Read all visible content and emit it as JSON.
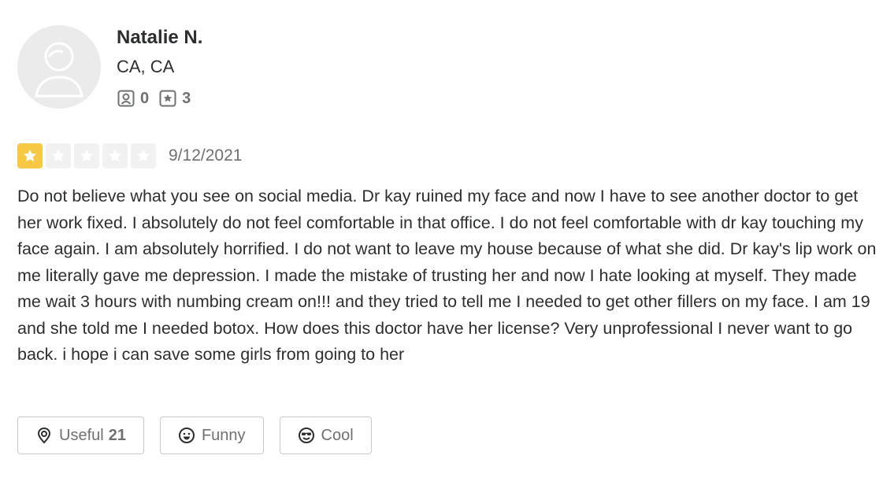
{
  "user": {
    "name": "Natalie N.",
    "location": "CA, CA",
    "friends_icon": "friends-icon",
    "friends_count": "0",
    "reviews_icon": "reviews-star-icon",
    "reviews_count": "3"
  },
  "review": {
    "rating": 1,
    "max_rating": 5,
    "rating_color": "#f7c844",
    "date": "9/12/2021",
    "text": "Do not believe what you see on social media. Dr kay ruined my face and now I have to see another doctor to get her work fixed. I absolutely do not feel comfortable in that office. I do not feel comfortable with dr kay touching my face again. I am absolutely horrified. I do not want to leave my house because of what she did. Dr kay's lip work on me literally gave me depression. I made the mistake of trusting her and now I hate looking at myself. They made me wait 3 hours with numbing cream on!!! and they tried to tell me I needed to get other fillers on my face. I am 19 and she told me I needed botox. How does this doctor have her license? Very unprofessional I never want to go back. i hope i can save some girls from going to her"
  },
  "reactions": {
    "useful_label": "Useful",
    "useful_count": "21",
    "useful_icon": "lightbulb-icon",
    "funny_label": "Funny",
    "funny_icon": "smile-icon",
    "cool_label": "Cool",
    "cool_icon": "sunglasses-icon"
  }
}
